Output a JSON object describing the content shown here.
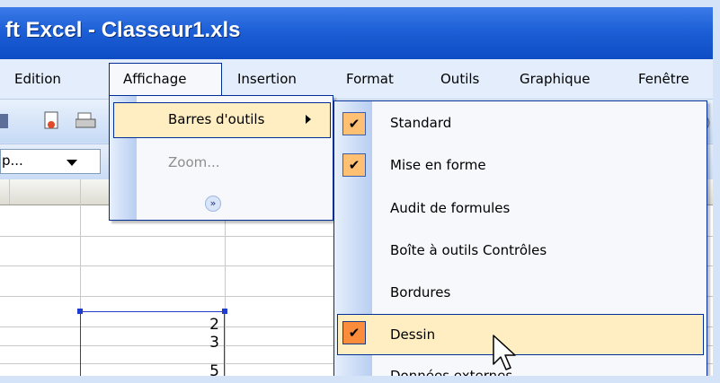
{
  "window": {
    "title": "ft Excel - Classeur1.xls"
  },
  "menubar": {
    "items": [
      {
        "label": "Edition"
      },
      {
        "label": "Affichage"
      },
      {
        "label": "Insertion"
      },
      {
        "label": "Format"
      },
      {
        "label": "Outils"
      },
      {
        "label": "Graphique"
      },
      {
        "label": "Fenêtre"
      }
    ]
  },
  "formatting": {
    "font_combo_value": "p..."
  },
  "sheet": {
    "cells": [
      "2",
      "3",
      "5"
    ]
  },
  "affichage_menu": {
    "items": [
      {
        "label": "Barres d'outils",
        "enabled": true,
        "has_submenu": true
      },
      {
        "label": "Zoom...",
        "enabled": false
      }
    ],
    "expand_icon": "chevron-double-down-icon"
  },
  "toolbars_submenu": {
    "items": [
      {
        "label": "Standard",
        "checked": true
      },
      {
        "label": "Mise en forme",
        "checked": true
      },
      {
        "label": "Audit de formules",
        "checked": false
      },
      {
        "label": "Boîte à outils Contrôles",
        "checked": false
      },
      {
        "label": "Bordures",
        "checked": false
      },
      {
        "label": "Dessin",
        "checked": true,
        "highlighted": true
      },
      {
        "label": "Données externes",
        "checked": false
      }
    ]
  },
  "colors": {
    "title_bar": "#1d5fd6",
    "menu_highlight": "#ffeec2",
    "check_bg": "#ffc073",
    "check_hot": "#fb8c3c",
    "menu_border": "#002d96"
  }
}
